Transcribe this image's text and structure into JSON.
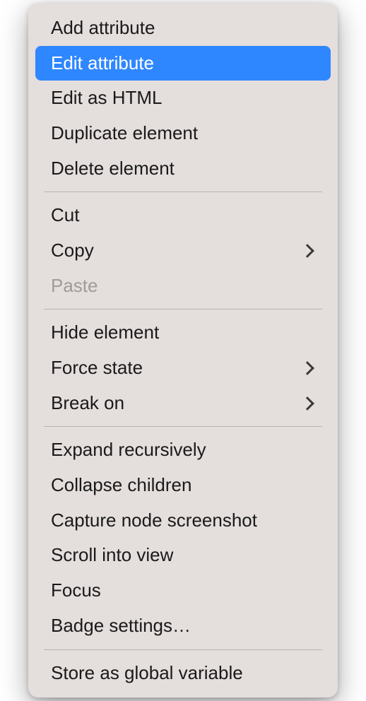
{
  "menu": {
    "sections": [
      {
        "items": [
          {
            "id": "add-attribute",
            "label": "Add attribute",
            "submenu": false,
            "disabled": false,
            "highlighted": false
          },
          {
            "id": "edit-attribute",
            "label": "Edit attribute",
            "submenu": false,
            "disabled": false,
            "highlighted": true
          },
          {
            "id": "edit-as-html",
            "label": "Edit as HTML",
            "submenu": false,
            "disabled": false,
            "highlighted": false
          },
          {
            "id": "duplicate-element",
            "label": "Duplicate element",
            "submenu": false,
            "disabled": false,
            "highlighted": false
          },
          {
            "id": "delete-element",
            "label": "Delete element",
            "submenu": false,
            "disabled": false,
            "highlighted": false
          }
        ]
      },
      {
        "items": [
          {
            "id": "cut",
            "label": "Cut",
            "submenu": false,
            "disabled": false,
            "highlighted": false
          },
          {
            "id": "copy",
            "label": "Copy",
            "submenu": true,
            "disabled": false,
            "highlighted": false
          },
          {
            "id": "paste",
            "label": "Paste",
            "submenu": false,
            "disabled": true,
            "highlighted": false
          }
        ]
      },
      {
        "items": [
          {
            "id": "hide-element",
            "label": "Hide element",
            "submenu": false,
            "disabled": false,
            "highlighted": false
          },
          {
            "id": "force-state",
            "label": "Force state",
            "submenu": true,
            "disabled": false,
            "highlighted": false
          },
          {
            "id": "break-on",
            "label": "Break on",
            "submenu": true,
            "disabled": false,
            "highlighted": false
          }
        ]
      },
      {
        "items": [
          {
            "id": "expand-recursively",
            "label": "Expand recursively",
            "submenu": false,
            "disabled": false,
            "highlighted": false
          },
          {
            "id": "collapse-children",
            "label": "Collapse children",
            "submenu": false,
            "disabled": false,
            "highlighted": false
          },
          {
            "id": "capture-node-screenshot",
            "label": "Capture node screenshot",
            "submenu": false,
            "disabled": false,
            "highlighted": false
          },
          {
            "id": "scroll-into-view",
            "label": "Scroll into view",
            "submenu": false,
            "disabled": false,
            "highlighted": false
          },
          {
            "id": "focus",
            "label": "Focus",
            "submenu": false,
            "disabled": false,
            "highlighted": false
          },
          {
            "id": "badge-settings",
            "label": "Badge settings…",
            "submenu": false,
            "disabled": false,
            "highlighted": false
          }
        ]
      },
      {
        "items": [
          {
            "id": "store-as-global-variable",
            "label": "Store as global variable",
            "submenu": false,
            "disabled": false,
            "highlighted": false
          }
        ]
      }
    ]
  }
}
